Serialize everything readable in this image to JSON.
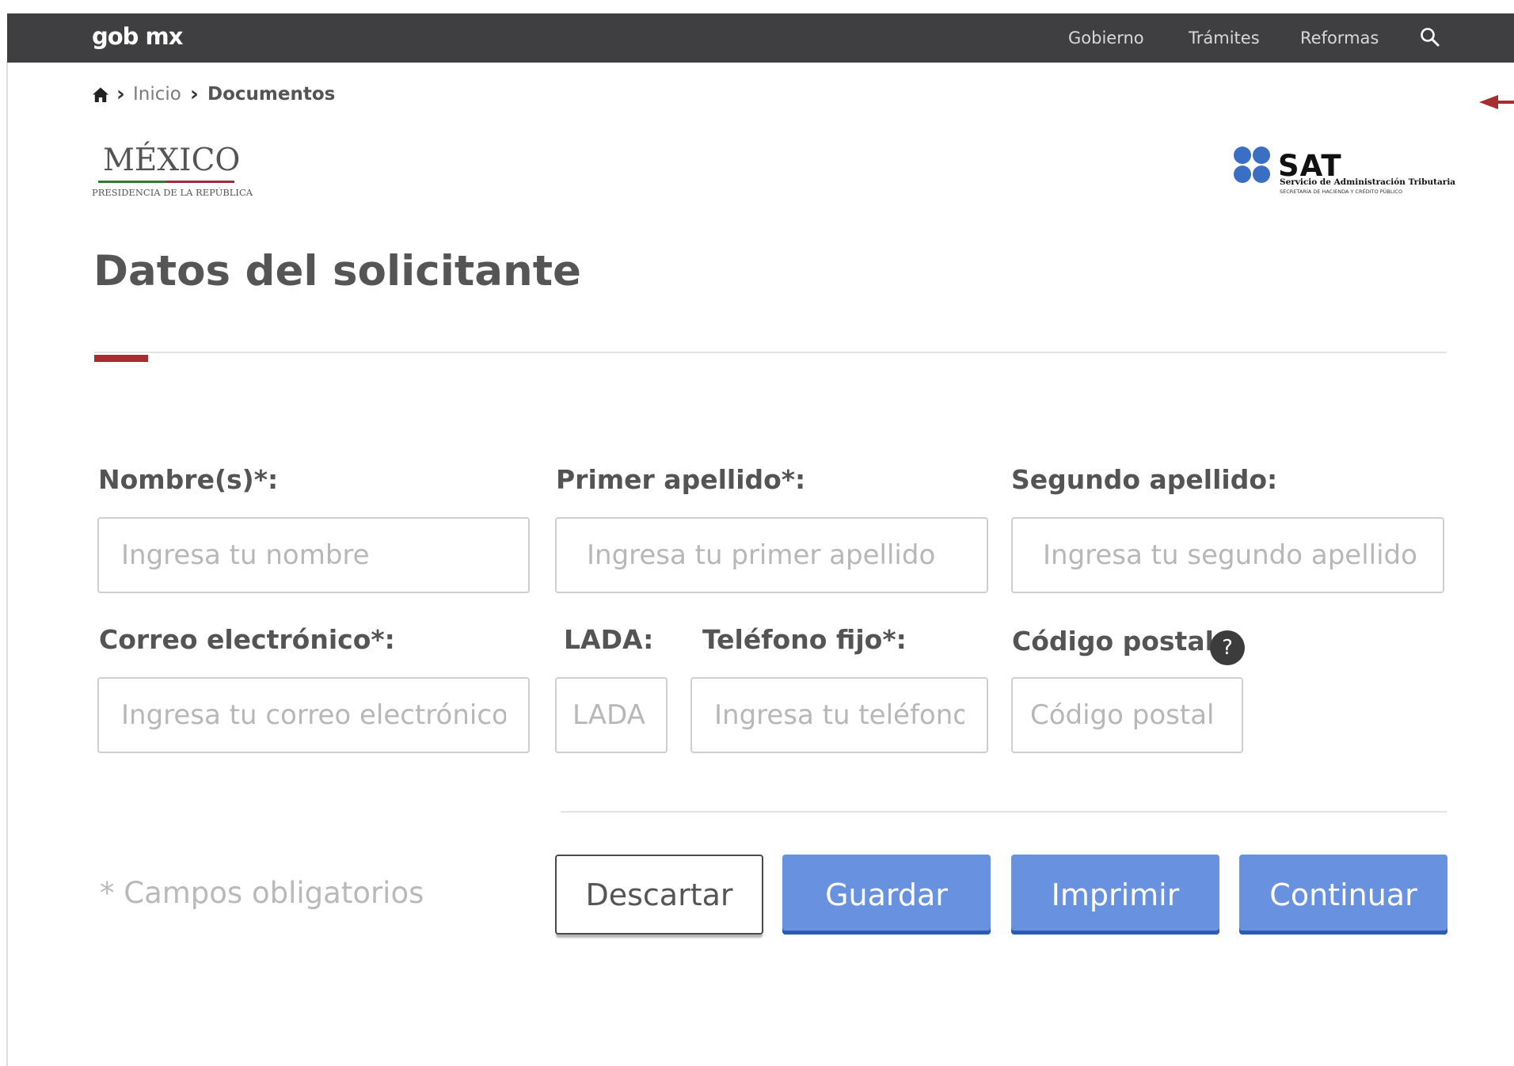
{
  "header": {
    "brand": "gob mx",
    "nav": [
      "Gobierno",
      "Trámites",
      "Reformas"
    ]
  },
  "breadcrumb": {
    "items": [
      "Inicio",
      "Documentos"
    ]
  },
  "logos": {
    "mexico": {
      "title": "MÉXICO",
      "subtitle": "PRESIDENCIA DE LA REPÚBLICA"
    },
    "sat": {
      "name": "SAT",
      "description": "Servicio de Administración Tributaria",
      "subtitle": "SECRETARÍA DE HACIENDA Y CRÉDITO PÚBLICO"
    }
  },
  "page": {
    "title": "Datos del solicitante"
  },
  "form": {
    "nombre": {
      "label": "Nombre(s)*:",
      "placeholder": "Ingresa tu nombre"
    },
    "primer_apellido": {
      "label": "Primer apellido*:",
      "placeholder": "Ingresa tu primer apellido"
    },
    "segundo_apellido": {
      "label": "Segundo apellido:",
      "placeholder": "Ingresa tu segundo apellido"
    },
    "correo": {
      "label": "Correo electrónico*:",
      "placeholder": "Ingresa tu correo electrónico"
    },
    "lada": {
      "label": "LADA:",
      "placeholder": "LADA"
    },
    "telefono": {
      "label": "Teléfono fijo*:",
      "placeholder": "Ingresa tu teléfono"
    },
    "codigo_postal": {
      "label": "Código postal:",
      "placeholder": "Código postal",
      "help": "?"
    },
    "required_note": "* Campos obligatorios"
  },
  "actions": {
    "discard": "Descartar",
    "save": "Guardar",
    "print": "Imprimir",
    "continue": "Continuar"
  },
  "colors": {
    "topbar": "#3f3f41",
    "accent_red": "#a92c30",
    "primary_button": "#6892e0",
    "primary_button_shadow": "#2b5bb3",
    "mexico_green": "#2e7d32",
    "sat_blue": "#3a6fc4"
  },
  "icons": {
    "home": "home-icon",
    "search": "search-icon",
    "breadcrumb_separator": "chevron-right-icon",
    "help": "help-icon",
    "side_arrow": "arrow-left-icon"
  }
}
